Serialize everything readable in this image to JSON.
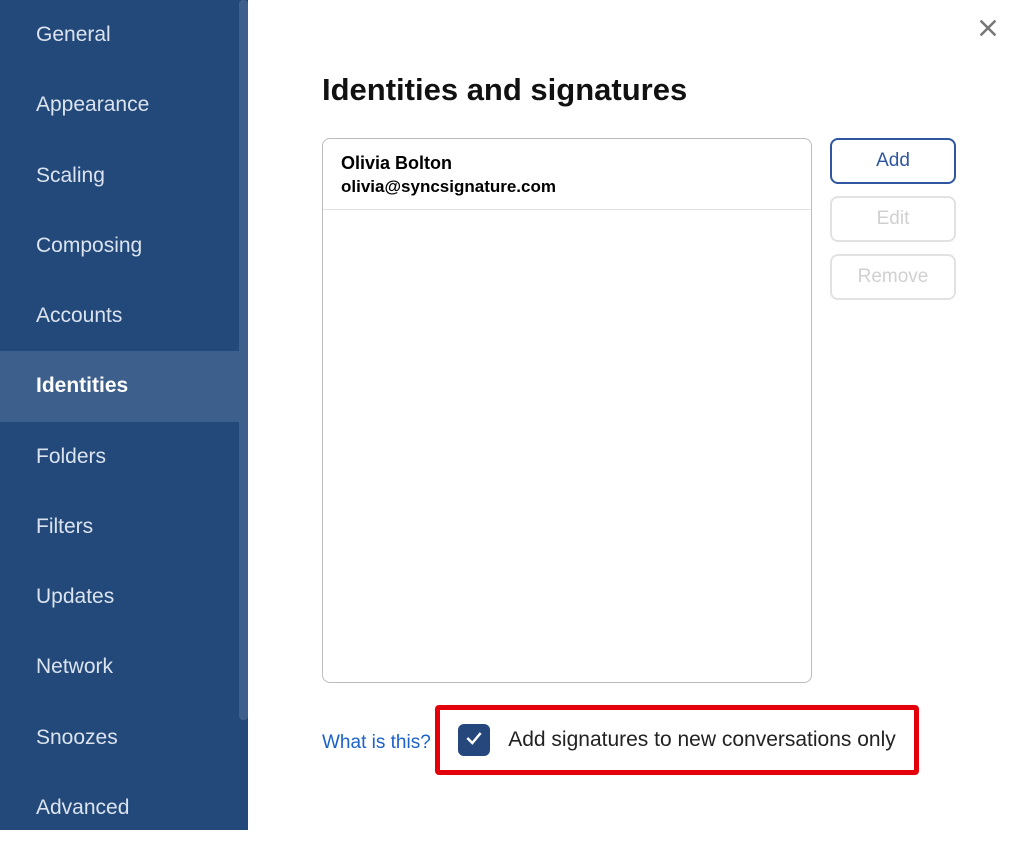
{
  "sidebar": {
    "items": [
      {
        "label": "General",
        "active": false
      },
      {
        "label": "Appearance",
        "active": false
      },
      {
        "label": "Scaling",
        "active": false
      },
      {
        "label": "Composing",
        "active": false
      },
      {
        "label": "Accounts",
        "active": false
      },
      {
        "label": "Identities",
        "active": true
      },
      {
        "label": "Folders",
        "active": false
      },
      {
        "label": "Filters",
        "active": false
      },
      {
        "label": "Updates",
        "active": false
      },
      {
        "label": "Network",
        "active": false
      },
      {
        "label": "Snoozes",
        "active": false
      },
      {
        "label": "Advanced",
        "active": false
      }
    ]
  },
  "main": {
    "title": "Identities and signatures",
    "identities": [
      {
        "name": "Olivia Bolton",
        "email": "olivia@syncsignature.com"
      }
    ],
    "buttons": {
      "add": "Add",
      "edit": "Edit",
      "remove": "Remove"
    },
    "help_link": "What is this?",
    "checkbox_label": "Add signatures to new conversations only",
    "checkbox_checked": true
  }
}
